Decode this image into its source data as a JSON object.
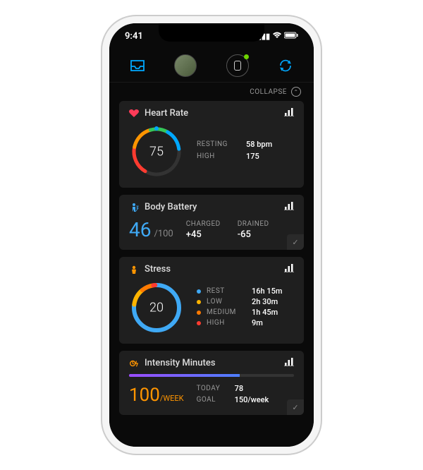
{
  "status_bar": {
    "time": "9:41"
  },
  "collapse": {
    "label": "COLLAPSE"
  },
  "heart_rate": {
    "title": "Heart Rate",
    "value": "75",
    "resting_label": "RESTING",
    "resting_value": "58 bpm",
    "high_label": "HIGH",
    "high_value": "175"
  },
  "body_battery": {
    "title": "Body Battery",
    "value": "46",
    "max": "/100",
    "charged_label": "CHARGED",
    "charged_value": "+45",
    "drained_label": "DRAINED",
    "drained_value": "-65"
  },
  "stress": {
    "title": "Stress",
    "value": "20",
    "items": [
      {
        "label": "REST",
        "value": "16h 15m",
        "color": "#3fa9f5"
      },
      {
        "label": "LOW",
        "value": "2h 30m",
        "color": "#ffb400"
      },
      {
        "label": "MEDIUM",
        "value": "1h 45m",
        "color": "#ff7a00"
      },
      {
        "label": "HIGH",
        "value": "9m",
        "color": "#ff3b30"
      }
    ]
  },
  "intensity": {
    "title": "Intensity Minutes",
    "value": "100",
    "unit": "/WEEK",
    "today_label": "TODAY",
    "today_value": "78",
    "goal_label": "GOAL",
    "goal_value": "150/week"
  }
}
